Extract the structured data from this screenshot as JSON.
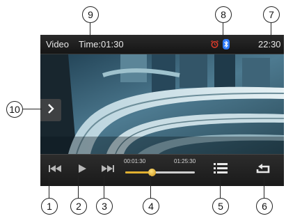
{
  "status_bar": {
    "mode_label": "Video",
    "time_label": "Time:01:30",
    "clock": "22:30"
  },
  "playback": {
    "elapsed": "00:01:30",
    "total": "01:25:30",
    "progress": 0.38
  },
  "callouts": {
    "prev": "1",
    "play": "2",
    "next": "3",
    "progress": "4",
    "list": "5",
    "repeat": "6",
    "clock": "7",
    "bluetooth": "8",
    "time": "9",
    "side_menu": "10"
  },
  "colors": {
    "accent": "#e0b030",
    "bluetooth": "#2f7bff",
    "alarm": "#d83a2a"
  },
  "icons": {
    "prev": "skip-previous-icon",
    "play": "play-icon",
    "next": "skip-next-icon",
    "list": "list-icon",
    "repeat": "repeat-icon",
    "side_menu": "chevron-right-icon",
    "bluetooth": "bluetooth-icon",
    "alarm": "alarm-icon"
  }
}
